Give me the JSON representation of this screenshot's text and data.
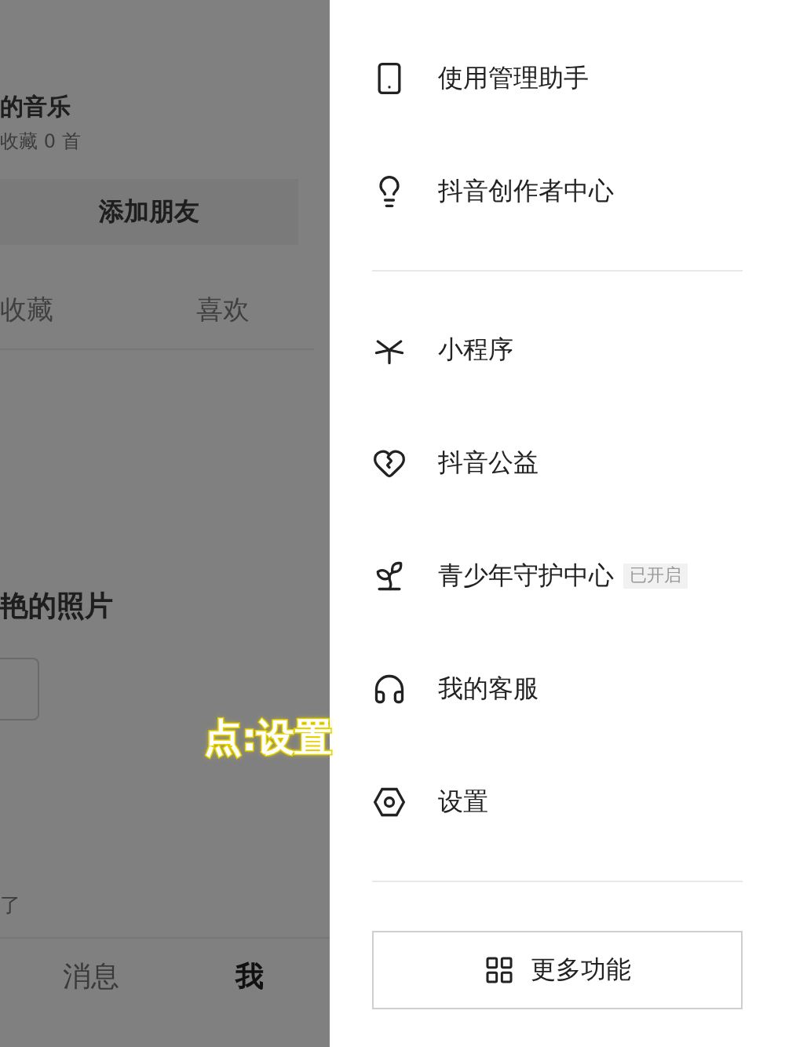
{
  "background": {
    "music_title": "的音乐",
    "music_count": "收藏 0 首",
    "add_friend_button": "添加朋友",
    "tabs": [
      "收藏",
      "喜欢"
    ],
    "section_title": "艳的照片",
    "note": "了",
    "bottom_nav": [
      {
        "label": "消息",
        "selected": false
      },
      {
        "label": "我",
        "selected": true
      }
    ]
  },
  "drawer": {
    "groups": [
      {
        "items": [
          {
            "label": "使用管理助手"
          },
          {
            "label": "抖音创作者中心"
          }
        ]
      },
      {
        "items": [
          {
            "label": "小程序"
          },
          {
            "label": "抖音公益"
          },
          {
            "label": "青少年守护中心",
            "badge": "已开启"
          },
          {
            "label": "我的客服"
          },
          {
            "label": "设置"
          }
        ]
      }
    ],
    "more_button": "更多功能"
  },
  "caption": "点:设置"
}
